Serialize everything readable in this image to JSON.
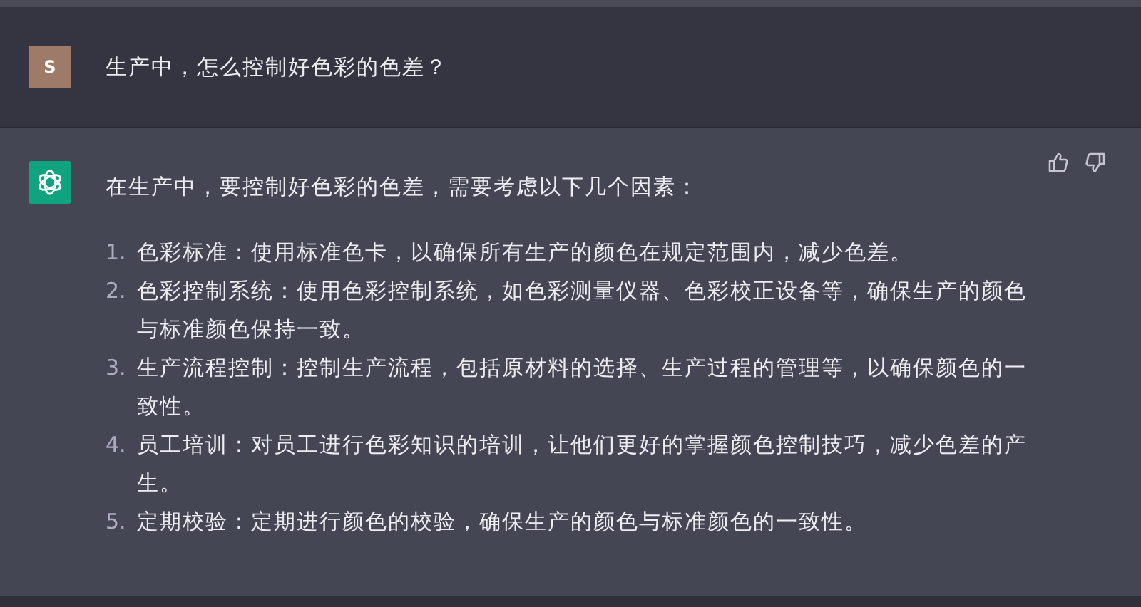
{
  "messages": [
    {
      "kind": "user",
      "avatar": "S",
      "text": "生产中，怎么控制好色彩的色差？"
    },
    {
      "kind": "assistant",
      "text": "在生产中，要控制好色彩的色差，需要考虑以下几个因素：",
      "list": [
        {
          "number": "1.",
          "text": "色彩标准：使用标准色卡，以确保所有生产的颜色在规定范围内，减少色差。"
        },
        {
          "number": "2.",
          "text": "色彩控制系统：使用色彩控制系统，如色彩测量仪器、色彩校正设备等，确保生产的颜色与标准颜色保持一致。"
        },
        {
          "number": "3.",
          "text": "生产流程控制：控制生产流程，包括原材料的选择、生产过程的管理等，以确保颜色的一致性。"
        },
        {
          "number": "4.",
          "text": "员工培训：对员工进行色彩知识的培训，让他们更好的掌握颜色控制技巧，减少色差的产生。"
        },
        {
          "number": "5.",
          "text": "定期校验：定期进行颜色的校验，确保生产的颜色与标准颜色的一致性。"
        }
      ]
    }
  ]
}
